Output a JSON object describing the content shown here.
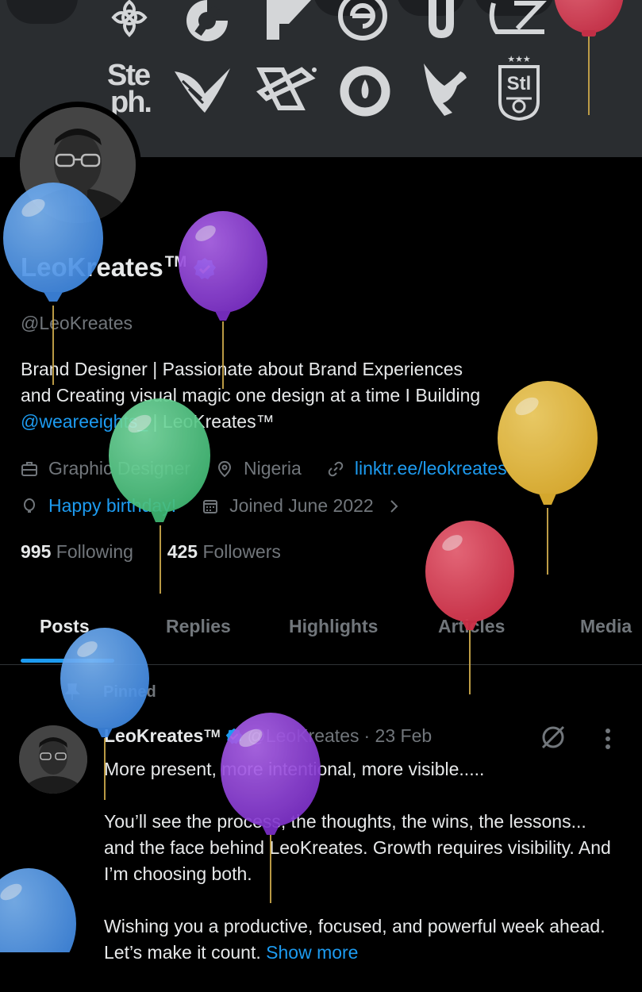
{
  "banner": {
    "logos": [
      "flower-logo",
      "c-logo",
      "p-logo",
      "e-circle-logo",
      "u-logo",
      "lz-logo",
      "steph-logo",
      "wings-logo",
      "x-star-logo",
      "drop-ring-logo",
      "bird-logo",
      "stl-badge-logo"
    ],
    "steph_text": "Ste ph.",
    "stl_text": "Stl"
  },
  "profile": {
    "name": "LeoKreates",
    "tm": "TM",
    "handle": "@LeoKreates",
    "bio_line1": "Brand Designer | Passionate about Brand Experiences",
    "bio_line2": "and Creating visual magic one design at a time I Building",
    "bio_link": "@weareeights_",
    "bio_tail": " | LeoKreates™",
    "category": "Graphic Designer",
    "location": "Nigeria",
    "website": "linktr.ee/leokreates",
    "birthday": "Happy birthday!",
    "joined": "Joined June 2022",
    "following_count": "995",
    "following_label": "Following",
    "followers_count": "425",
    "followers_label": "Followers"
  },
  "tabs": [
    "Posts",
    "Replies",
    "Highlights",
    "Articles",
    "Media"
  ],
  "active_tab": "Posts",
  "post": {
    "pinned_label": "Pinned",
    "author": "LeoKreates",
    "author_tm": "TM",
    "handle": "@LeoKreates",
    "date": "· 23 Feb",
    "paragraph1": "More present, more intentional, more visible.....",
    "paragraph2": "You’ll see the process, the thoughts, the wins, the lessons... and the face behind LeoKreates. Growth requires visibility. And I’m choosing both.",
    "paragraph3_start": "Wishing you a productive, focused, and powerful week ahead. Let’s make it count.",
    "show_more": "Show more"
  },
  "colors": {
    "background": "#000000",
    "banner": "#2a2d30",
    "text": "#e7e9ea",
    "muted": "#71767b",
    "accent": "#1d9bf0",
    "balloon_blue": "#4a90e2",
    "balloon_purple": "#8e3bd6",
    "balloon_green": "#4fc584",
    "balloon_yellow": "#e9bb3e",
    "balloon_red": "#d93d52"
  }
}
